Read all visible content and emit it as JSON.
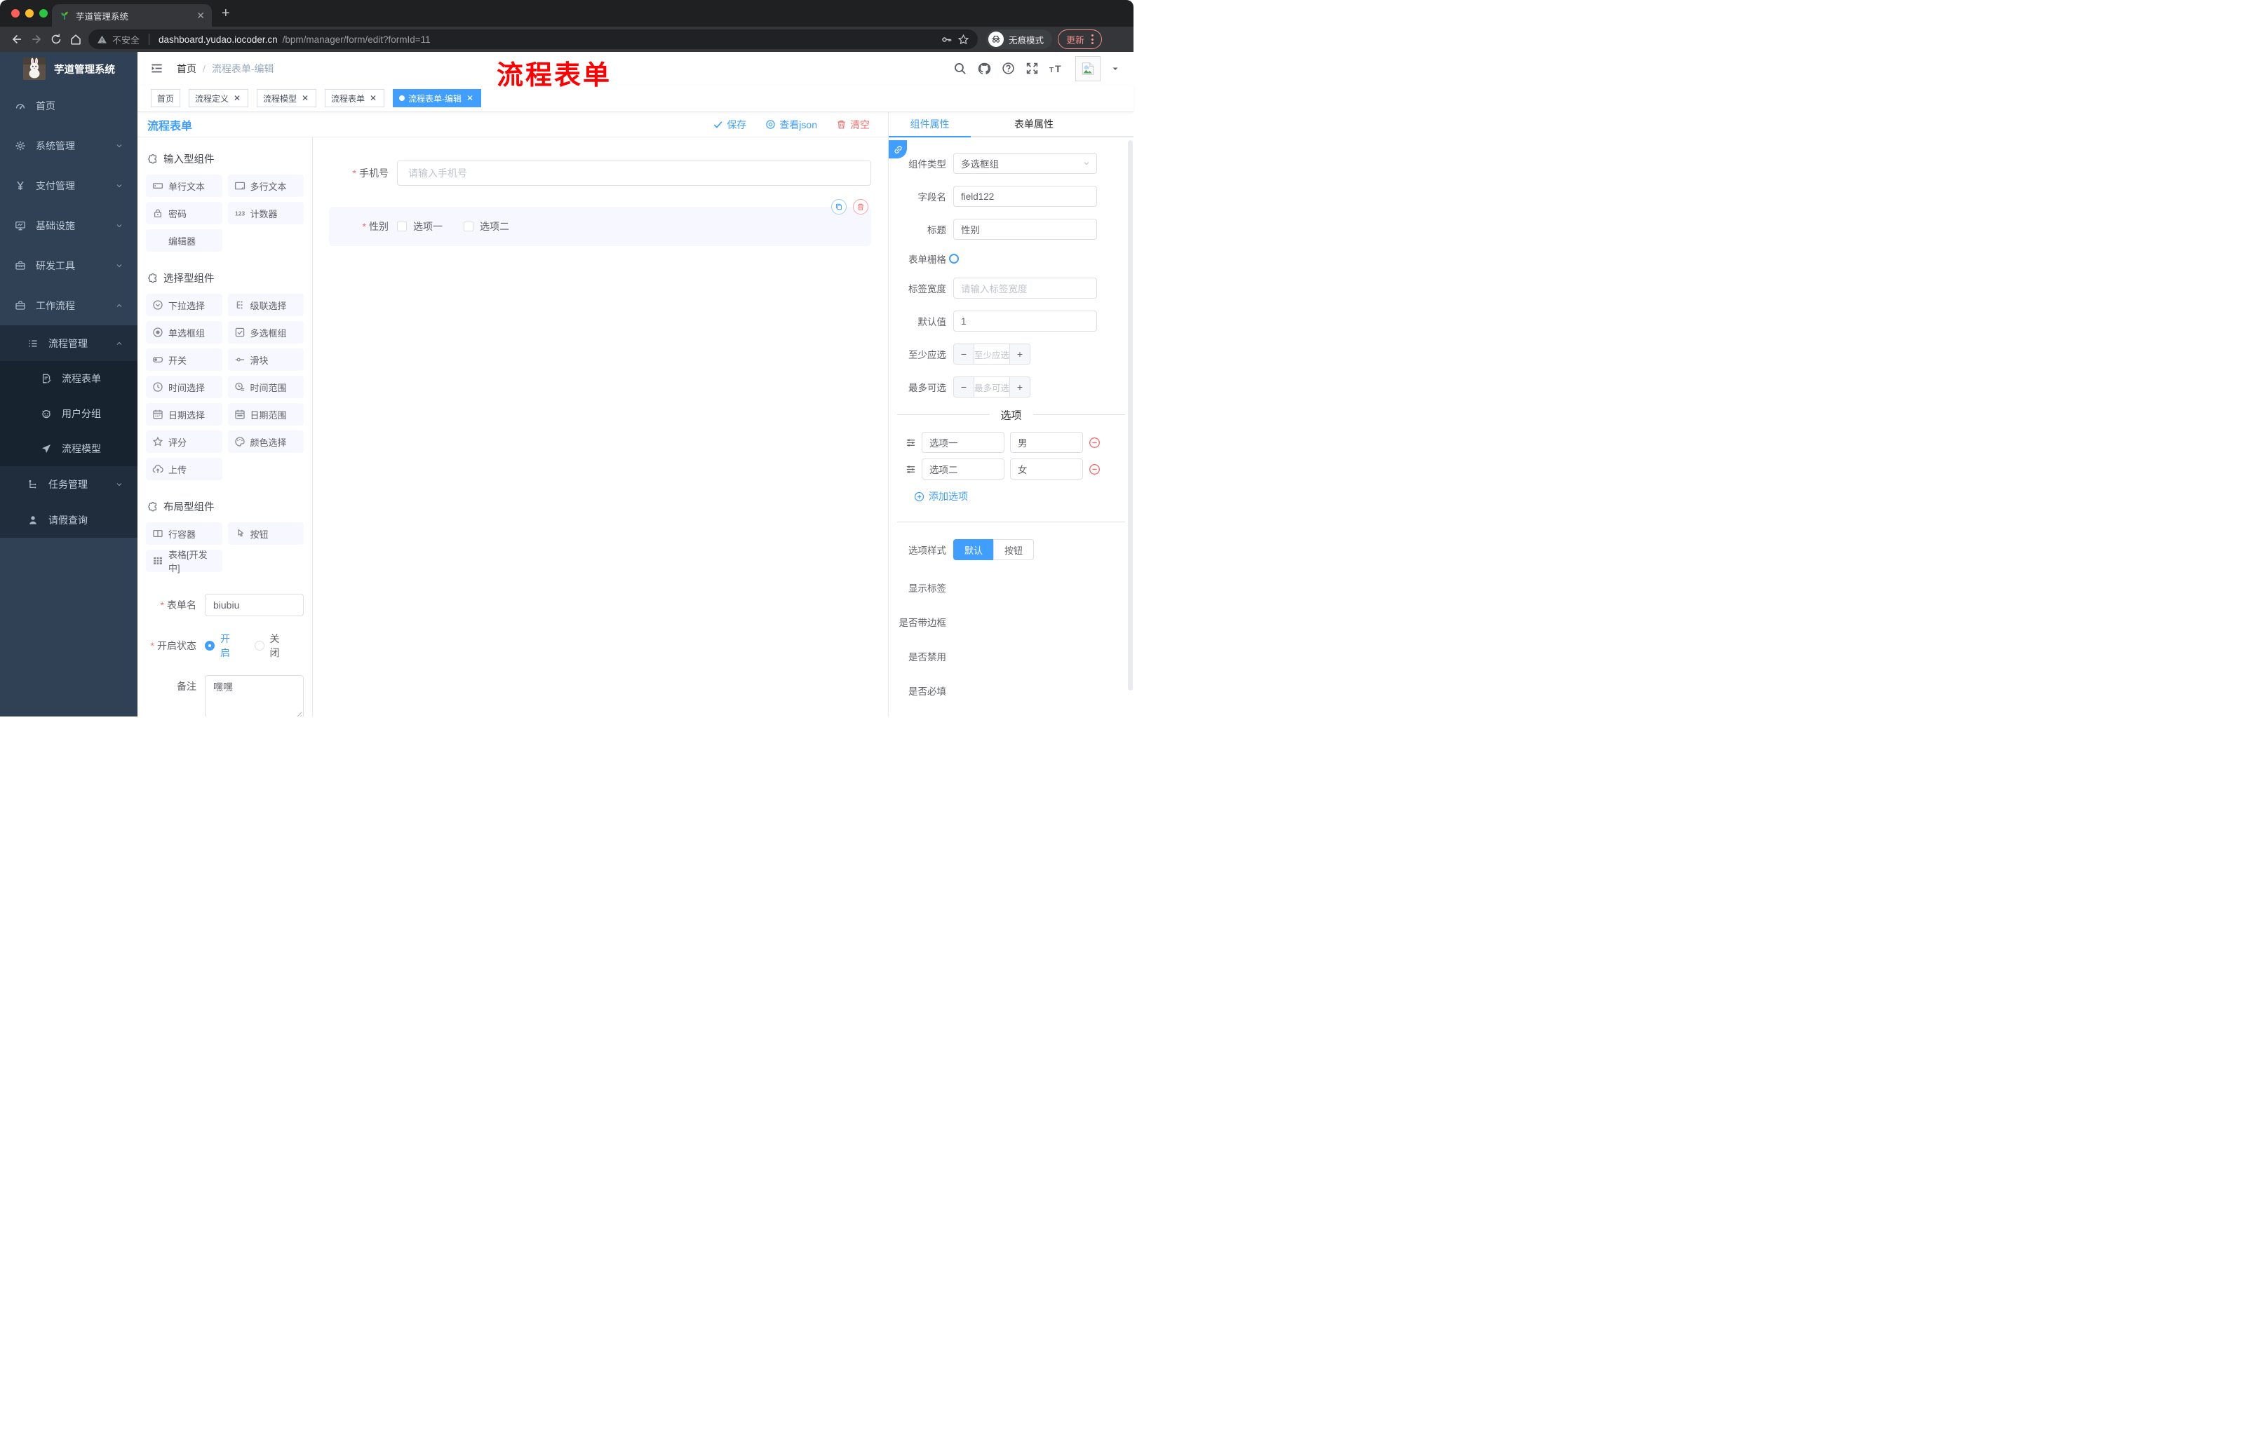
{
  "colors": {
    "accent": "#409EFF",
    "danger": "#F56C6C",
    "annotation": "#FF0000",
    "sidebar_bg": "#304156"
  },
  "browser": {
    "tab_title": "芋道管理系统",
    "security_label": "不安全",
    "url_host": "dashboard.yudao.iocoder.cn",
    "url_path": "/bpm/manager/form/edit?formId=11",
    "incognito_label": "无痕模式",
    "update_label": "更新"
  },
  "sidebar": {
    "logo_title": "芋道管理系统",
    "items": [
      {
        "label": "首页",
        "icon": "dashboard-icon",
        "level": 1,
        "chevron": ""
      },
      {
        "label": "系统管理",
        "icon": "gear-icon",
        "level": 1,
        "chevron": "down"
      },
      {
        "label": "支付管理",
        "icon": "yen-icon",
        "level": 1,
        "chevron": "down"
      },
      {
        "label": "基础设施",
        "icon": "monitor-icon",
        "level": 1,
        "chevron": "down"
      },
      {
        "label": "研发工具",
        "icon": "toolbox-icon",
        "level": 1,
        "chevron": "down"
      },
      {
        "label": "工作流程",
        "icon": "briefcase-icon",
        "level": 1,
        "chevron": "up"
      },
      {
        "label": "流程管理",
        "icon": "listtree-icon",
        "level": 2,
        "chevron": "up"
      },
      {
        "label": "流程表单",
        "icon": "form-edit-icon",
        "level": 3,
        "chevron": ""
      },
      {
        "label": "用户分组",
        "icon": "usergroup-icon",
        "level": 3,
        "chevron": ""
      },
      {
        "label": "流程模型",
        "icon": "paper-plane-icon",
        "level": 3,
        "chevron": ""
      },
      {
        "label": "任务管理",
        "icon": "tree-icon",
        "level": 2,
        "chevron": "down"
      },
      {
        "label": "请假查询",
        "icon": "user-icon",
        "level": 2,
        "chevron": ""
      }
    ]
  },
  "navbar": {
    "breadcrumb_home": "首页",
    "breadcrumb_current": "流程表单-编辑"
  },
  "annotation": {
    "text": "流程表单"
  },
  "tags": [
    {
      "label": "首页",
      "closable": false,
      "active": false
    },
    {
      "label": "流程定义",
      "closable": true,
      "active": false
    },
    {
      "label": "流程模型",
      "closable": true,
      "active": false
    },
    {
      "label": "流程表单",
      "closable": true,
      "active": false
    },
    {
      "label": "流程表单-编辑",
      "closable": true,
      "active": true
    }
  ],
  "designer": {
    "title": "流程表单",
    "actions": [
      {
        "label": "保存",
        "icon": "check-icon",
        "color": "#409EFF"
      },
      {
        "label": "查看json",
        "icon": "view-icon",
        "color": "#409EFF"
      },
      {
        "label": "清空",
        "icon": "trash-icon",
        "color": "#F56C6C"
      }
    ]
  },
  "components_panel": {
    "sections": [
      {
        "title": "输入型组件",
        "items": [
          {
            "label": "单行文本",
            "icon": "input-icon"
          },
          {
            "label": "多行文本",
            "icon": "textarea-icon"
          },
          {
            "label": "密码",
            "icon": "lock-icon"
          },
          {
            "label": "计数器",
            "icon": "counter-icon"
          },
          {
            "label": "编辑器",
            "icon": "blank-icon"
          }
        ]
      },
      {
        "title": "选择型组件",
        "items": [
          {
            "label": "下拉选择",
            "icon": "select-icon"
          },
          {
            "label": "级联选择",
            "icon": "cascade-icon"
          },
          {
            "label": "单选框组",
            "icon": "radio-icon"
          },
          {
            "label": "多选框组",
            "icon": "checkbox-icon"
          },
          {
            "label": "开关",
            "icon": "switch-icon"
          },
          {
            "label": "滑块",
            "icon": "slider-icon"
          },
          {
            "label": "时间选择",
            "icon": "clock-icon"
          },
          {
            "label": "时间范围",
            "icon": "clock-range-icon"
          },
          {
            "label": "日期选择",
            "icon": "calendar-icon"
          },
          {
            "label": "日期范围",
            "icon": "calendar-range-icon"
          },
          {
            "label": "评分",
            "icon": "star-icon"
          },
          {
            "label": "颜色选择",
            "icon": "palette-icon"
          },
          {
            "label": "上传",
            "icon": "upload-icon"
          }
        ]
      },
      {
        "title": "布局型组件",
        "items": [
          {
            "label": "行容器",
            "icon": "row-icon"
          },
          {
            "label": "按钮",
            "icon": "pointer-icon"
          },
          {
            "label": "表格[开发中]",
            "icon": "table-icon"
          }
        ]
      }
    ],
    "form": {
      "name_label": "表单名",
      "name_value": "biubiu",
      "status_label": "开启状态",
      "status_options": [
        {
          "label": "开启",
          "selected": true
        },
        {
          "label": "关闭",
          "selected": false
        }
      ],
      "remark_label": "备注",
      "remark_value": "嘿嘿"
    }
  },
  "canvas": {
    "phone": {
      "label": "手机号",
      "placeholder": "请输入手机号",
      "required": true
    },
    "gender": {
      "label": "性别",
      "required": true,
      "options": [
        "选项一",
        "选项二"
      ]
    }
  },
  "properties_panel": {
    "tabs": [
      {
        "label": "组件属性",
        "active": true
      },
      {
        "label": "表单属性",
        "active": false
      }
    ],
    "component_type": {
      "label": "组件类型",
      "value": "多选框组"
    },
    "field_name": {
      "label": "字段名",
      "value": "field122"
    },
    "title": {
      "label": "标题",
      "value": "性别"
    },
    "grid": {
      "label": "表单栅格"
    },
    "label_width": {
      "label": "标签宽度",
      "placeholder": "请输入标签宽度"
    },
    "default_value": {
      "label": "默认值",
      "value": "1"
    },
    "min_select": {
      "label": "至少应选",
      "placeholder": "至少应选"
    },
    "max_select": {
      "label": "最多可选",
      "placeholder": "最多可选"
    },
    "options_divider": "选项",
    "options": [
      {
        "label": "选项一",
        "value": "男"
      },
      {
        "label": "选项二",
        "value": "女"
      }
    ],
    "add_option_label": "添加选项",
    "style": {
      "label": "选项样式",
      "options": [
        {
          "label": "默认",
          "active": true
        },
        {
          "label": "按钮",
          "active": false
        }
      ]
    },
    "switches": [
      {
        "label": "显示标签",
        "on": true
      },
      {
        "label": "是否带边框",
        "on": false
      },
      {
        "label": "是否禁用",
        "on": false
      },
      {
        "label": "是否必填",
        "on": true
      }
    ]
  }
}
